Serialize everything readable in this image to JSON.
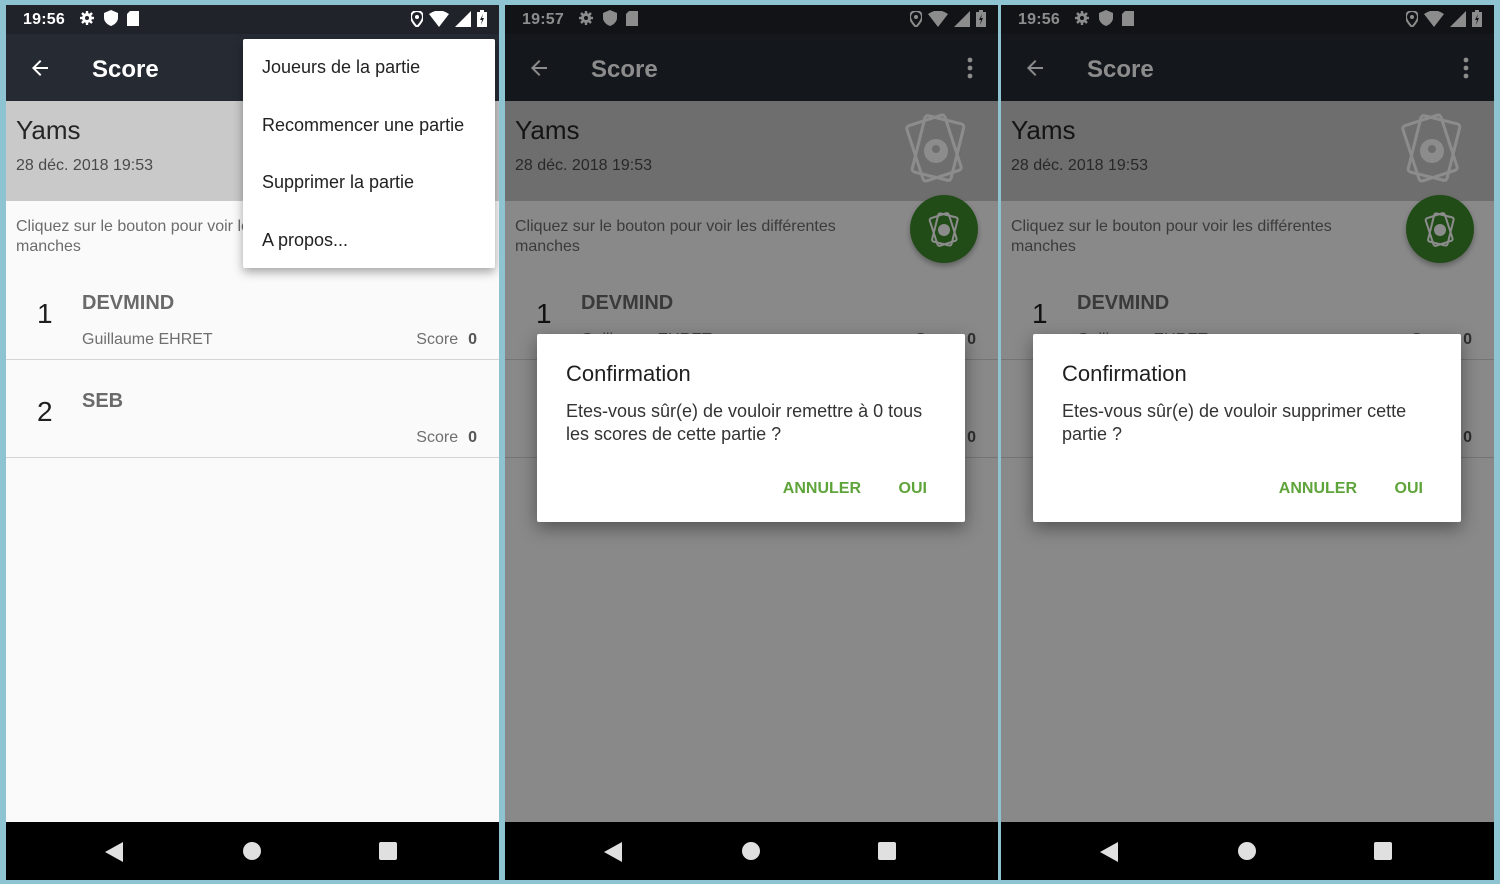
{
  "colors": {
    "accent": "#5fa43a",
    "fab": "#3c8a2a",
    "appbar": "#262a33",
    "header": "#c9c9c9"
  },
  "screens": [
    {
      "status_time": "19:56",
      "appbar_title": "Score",
      "game_name": "Yams",
      "game_date": "28 déc. 2018 19:53",
      "hint": "Cliquez sur le bouton pour voir les différentes manches",
      "menu_items": [
        "Joueurs de la partie",
        "Recommencer une partie",
        "Supprimer la partie",
        "A propos..."
      ]
    },
    {
      "status_time": "19:57",
      "dialog": {
        "title": "Confirmation",
        "message": "Etes-vous sûr(e) de vouloir remettre à 0 tous les scores de cette partie ?",
        "cancel": "ANNULER",
        "ok": "OUI"
      }
    },
    {
      "status_time": "19:56",
      "dialog": {
        "title": "Confirmation",
        "message": "Etes-vous sûr(e) de vouloir supprimer cette partie ?",
        "cancel": "ANNULER",
        "ok": "OUI"
      }
    }
  ],
  "players": [
    {
      "rank": "1",
      "team": "DEVMIND",
      "name": "Guillaume EHRET",
      "score_label": "Score",
      "score": "0"
    },
    {
      "rank": "2",
      "team": "SEB",
      "name": "",
      "score_label": "Score",
      "score": "0"
    }
  ],
  "icons": {
    "status": [
      "gear-icon",
      "shield-icon",
      "sd-card-icon",
      "location-icon",
      "wifi-icon",
      "signal-icon",
      "battery-icon"
    ],
    "app": [
      "back-arrow-icon",
      "more-vert-icon",
      "cards-logo-icon"
    ],
    "nav": [
      "nav-back-icon",
      "nav-home-icon",
      "nav-recent-icon"
    ]
  }
}
